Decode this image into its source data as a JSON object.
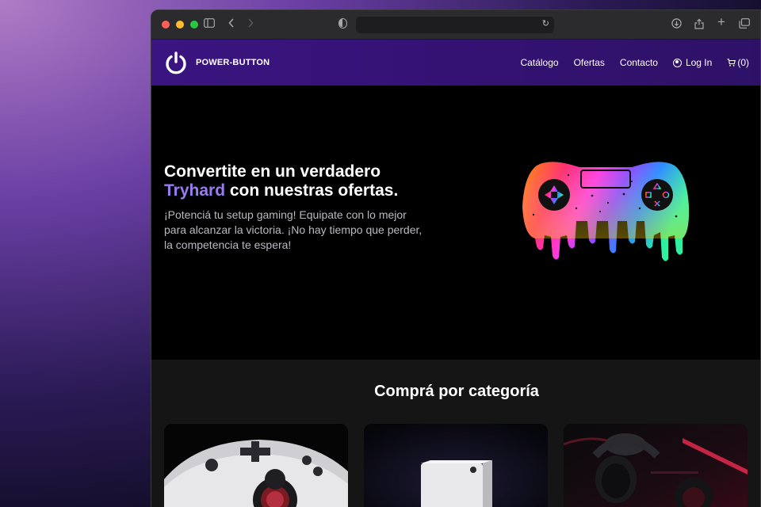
{
  "browser": {
    "icons": [
      "sidebar-icon",
      "back-icon",
      "forward-icon",
      "privacy-shield-icon",
      "reload-icon",
      "download-icon",
      "share-icon",
      "new-tab-icon",
      "tab-overview-icon"
    ]
  },
  "navbar": {
    "brand": "POWER-BUTTON",
    "links": [
      "Catálogo",
      "Ofertas",
      "Contacto"
    ],
    "login": "Log In",
    "cart": "(0)"
  },
  "hero": {
    "title_line1": "Convertite en un verdadero",
    "title_highlight": "Tryhard",
    "title_rest": "con nuestras ofertas.",
    "subtitle_line1": "¡Potenciá tu setup gaming! Equipate con lo mejor",
    "subtitle_line2": "para alcanzar la victoria. ¡No hay tiempo que perder,",
    "subtitle_line3": "la competencia te espera!"
  },
  "categories": {
    "title": "Comprá por categoría",
    "cards": [
      "controllers",
      "consoles",
      "headsets"
    ]
  },
  "colors": {
    "accent": "#9a7cf0",
    "navbar": "#3a1480",
    "hero_bg": "#000000",
    "section_bg": "#151515"
  }
}
